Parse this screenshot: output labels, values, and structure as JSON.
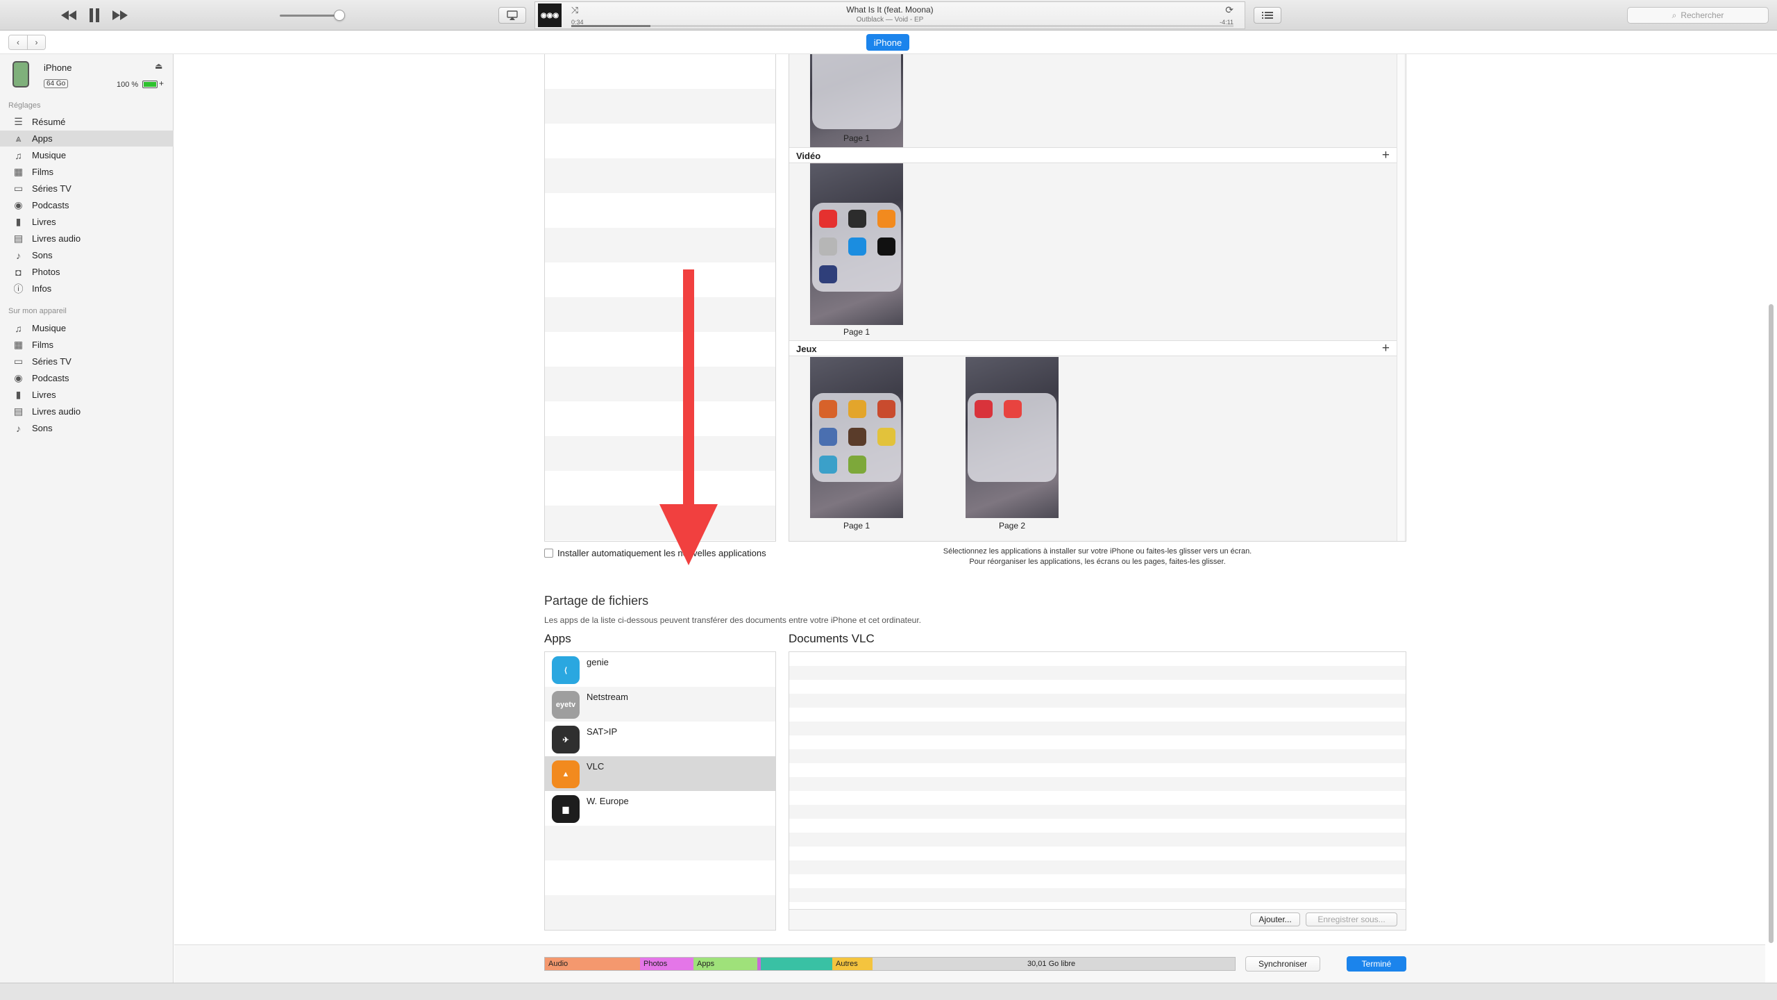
{
  "player": {
    "title": "What Is It (feat. Moona)",
    "subtitle": "Outblack — Void - EP",
    "elapsed": "0:34",
    "remaining": "-4:11",
    "progress": 0.12,
    "volume": 0.92,
    "search_placeholder": "Rechercher"
  },
  "nav": {
    "device_tab": "iPhone"
  },
  "device": {
    "name": "iPhone",
    "capacity": "64 Go",
    "battery": "100 %",
    "battery_level": 1.0
  },
  "sidebar": {
    "settings_header": "Réglages",
    "settings": [
      {
        "label": "Résumé",
        "icon": "summary-icon",
        "glyph": "☰"
      },
      {
        "label": "Apps",
        "icon": "apps-icon",
        "glyph": "⩓",
        "selected": true
      },
      {
        "label": "Musique",
        "icon": "music-note-icon",
        "glyph": "♫"
      },
      {
        "label": "Films",
        "icon": "film-icon",
        "glyph": "▦"
      },
      {
        "label": "Séries TV",
        "icon": "tv-icon",
        "glyph": "▭"
      },
      {
        "label": "Podcasts",
        "icon": "podcast-icon",
        "glyph": "◉"
      },
      {
        "label": "Livres",
        "icon": "book-icon",
        "glyph": "▮"
      },
      {
        "label": "Livres audio",
        "icon": "audiobook-icon",
        "glyph": "▤"
      },
      {
        "label": "Sons",
        "icon": "bell-icon",
        "glyph": "♪"
      },
      {
        "label": "Photos",
        "icon": "camera-icon",
        "glyph": "◘"
      },
      {
        "label": "Infos",
        "icon": "info-icon",
        "glyph": "ⓘ"
      }
    ],
    "device_header": "Sur mon appareil",
    "device_items": [
      {
        "label": "Musique",
        "icon": "music-note-icon",
        "glyph": "♫"
      },
      {
        "label": "Films",
        "icon": "film-icon",
        "glyph": "▦"
      },
      {
        "label": "Séries TV",
        "icon": "tv-icon",
        "glyph": "▭"
      },
      {
        "label": "Podcasts",
        "icon": "podcast-icon",
        "glyph": "◉"
      },
      {
        "label": "Livres",
        "icon": "book-icon",
        "glyph": "▮"
      },
      {
        "label": "Livres audio",
        "icon": "audiobook-icon",
        "glyph": "▤"
      },
      {
        "label": "Sons",
        "icon": "bell-icon",
        "glyph": "♪"
      }
    ]
  },
  "home_screens": {
    "sections": [
      {
        "label": "Vidéo",
        "pages": [
          "Page 1"
        ]
      },
      {
        "label": "Jeux",
        "pages": [
          "Page 1",
          "Page 2"
        ]
      }
    ],
    "top_page_label": "Page 1",
    "hint_line1": "Sélectionnez les applications à installer sur votre iPhone ou faites-les glisser vers un écran.",
    "hint_line2": "Pour réorganiser les applications, les écrans ou les pages, faites-les glisser.",
    "auto_install_label": "Installer automatiquement les nouvelles applications"
  },
  "file_sharing": {
    "title": "Partage de fichiers",
    "description": "Les apps de la liste ci-dessous peuvent transférer des documents entre votre iPhone et cet ordinateur.",
    "apps_header": "Apps",
    "docs_header": "Documents VLC",
    "apps": [
      {
        "name": "genie",
        "color": "#2aa7e0",
        "icon_text": "⟨"
      },
      {
        "name": "Netstream",
        "color": "#9e9e9e",
        "icon_text": "eyetv"
      },
      {
        "name": "SAT>IP",
        "color": "#2f2f2f",
        "icon_text": "✈"
      },
      {
        "name": "VLC",
        "color": "#f28a1e",
        "icon_text": "▲",
        "selected": true
      },
      {
        "name": "W. Europe",
        "color": "#1d1d1d",
        "icon_text": "▆"
      }
    ],
    "add_button": "Ajouter...",
    "save_button": "Enregistrer sous..."
  },
  "storage": {
    "segments": [
      {
        "label": "Audio",
        "color": "#f4986e",
        "fraction": 0.138
      },
      {
        "label": "Photos",
        "color": "#e476e8",
        "fraction": 0.077
      },
      {
        "label": "Apps",
        "color": "#9fe17a",
        "fraction": 0.093
      },
      {
        "label": "",
        "color": "#c96bd6",
        "fraction": 0.004
      },
      {
        "label": "",
        "color": "#39c1a4",
        "fraction": 0.104
      },
      {
        "label": "Autres",
        "color": "#f4c43e",
        "fraction": 0.058
      }
    ],
    "free_label": "30,01 Go libre",
    "sync_button": "Synchroniser",
    "done_button": "Terminé"
  }
}
